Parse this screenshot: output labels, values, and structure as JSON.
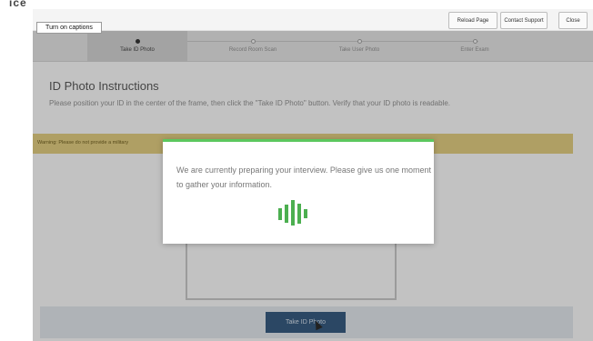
{
  "top": {
    "logo_fragment": "ice"
  },
  "toolbar": {
    "reload_label": "Reload Page",
    "support_label": "Contact Support",
    "close_label": "Close"
  },
  "tooltip": {
    "text": "Turn on captions"
  },
  "steps": [
    {
      "label": "Take ID Photo",
      "active": true
    },
    {
      "label": "Record Room Scan",
      "active": false
    },
    {
      "label": "Take User Photo",
      "active": false
    },
    {
      "label": "Enter Exam",
      "active": false
    }
  ],
  "main": {
    "heading": "ID Photo Instructions",
    "instructions": "Please position your ID in the center of the frame, then click the \"Take ID Photo\" button. Verify that your ID photo is readable.",
    "warning": "Warning: Please do not provide a military",
    "take_photo_label": "Take ID Photo"
  },
  "modal": {
    "message": "We are currently preparing your interview. Please give us one moment to gather your information."
  },
  "colors": {
    "accent_green": "#5cc75e",
    "primary_button": "#35577a",
    "warning_bg": "#d6c37a"
  },
  "icons": {
    "loader": "loading-bars-icon",
    "cursor": "mouse-cursor-icon"
  }
}
